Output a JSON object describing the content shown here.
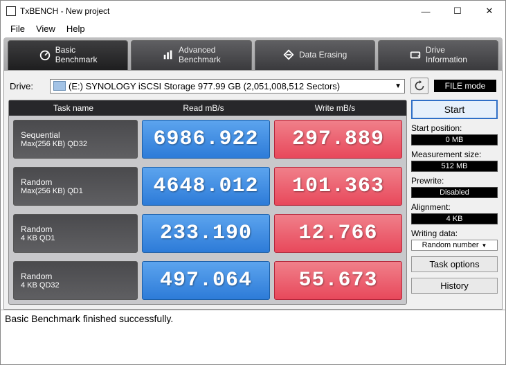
{
  "window": {
    "app": "TxBENCH",
    "project": "New project"
  },
  "menu": [
    "File",
    "View",
    "Help"
  ],
  "tabs": [
    {
      "line1": "Basic",
      "line2": "Benchmark"
    },
    {
      "line1": "Advanced",
      "line2": "Benchmark"
    },
    {
      "line1": "Data Erasing",
      "line2": ""
    },
    {
      "line1": "Drive",
      "line2": "Information"
    }
  ],
  "drive": {
    "label": "Drive:",
    "selected": "(E:) SYNOLOGY iSCSI Storage  977.99 GB (2,051,008,512 Sectors)",
    "mode": "FILE mode"
  },
  "headers": {
    "task": "Task name",
    "read": "Read mB/s",
    "write": "Write mB/s"
  },
  "rows": [
    {
      "l1": "Sequential",
      "l2": "Max(256 KB) QD32",
      "read": "6986.922",
      "write": "297.889"
    },
    {
      "l1": "Random",
      "l2": "Max(256 KB) QD1",
      "read": "4648.012",
      "write": "101.363"
    },
    {
      "l1": "Random",
      "l2": "4 KB QD1",
      "read": "233.190",
      "write": "12.766"
    },
    {
      "l1": "Random",
      "l2": "4 KB QD32",
      "read": "497.064",
      "write": "55.673"
    }
  ],
  "side": {
    "start": "Start",
    "startPosLbl": "Start position:",
    "startPos": "0 MB",
    "measLbl": "Measurement size:",
    "meas": "512 MB",
    "preLbl": "Prewrite:",
    "pre": "Disabled",
    "alignLbl": "Alignment:",
    "align": "4 KB",
    "wdLbl": "Writing data:",
    "wd": "Random number",
    "opts": "Task options",
    "hist": "History"
  },
  "status": "Basic Benchmark finished successfully."
}
